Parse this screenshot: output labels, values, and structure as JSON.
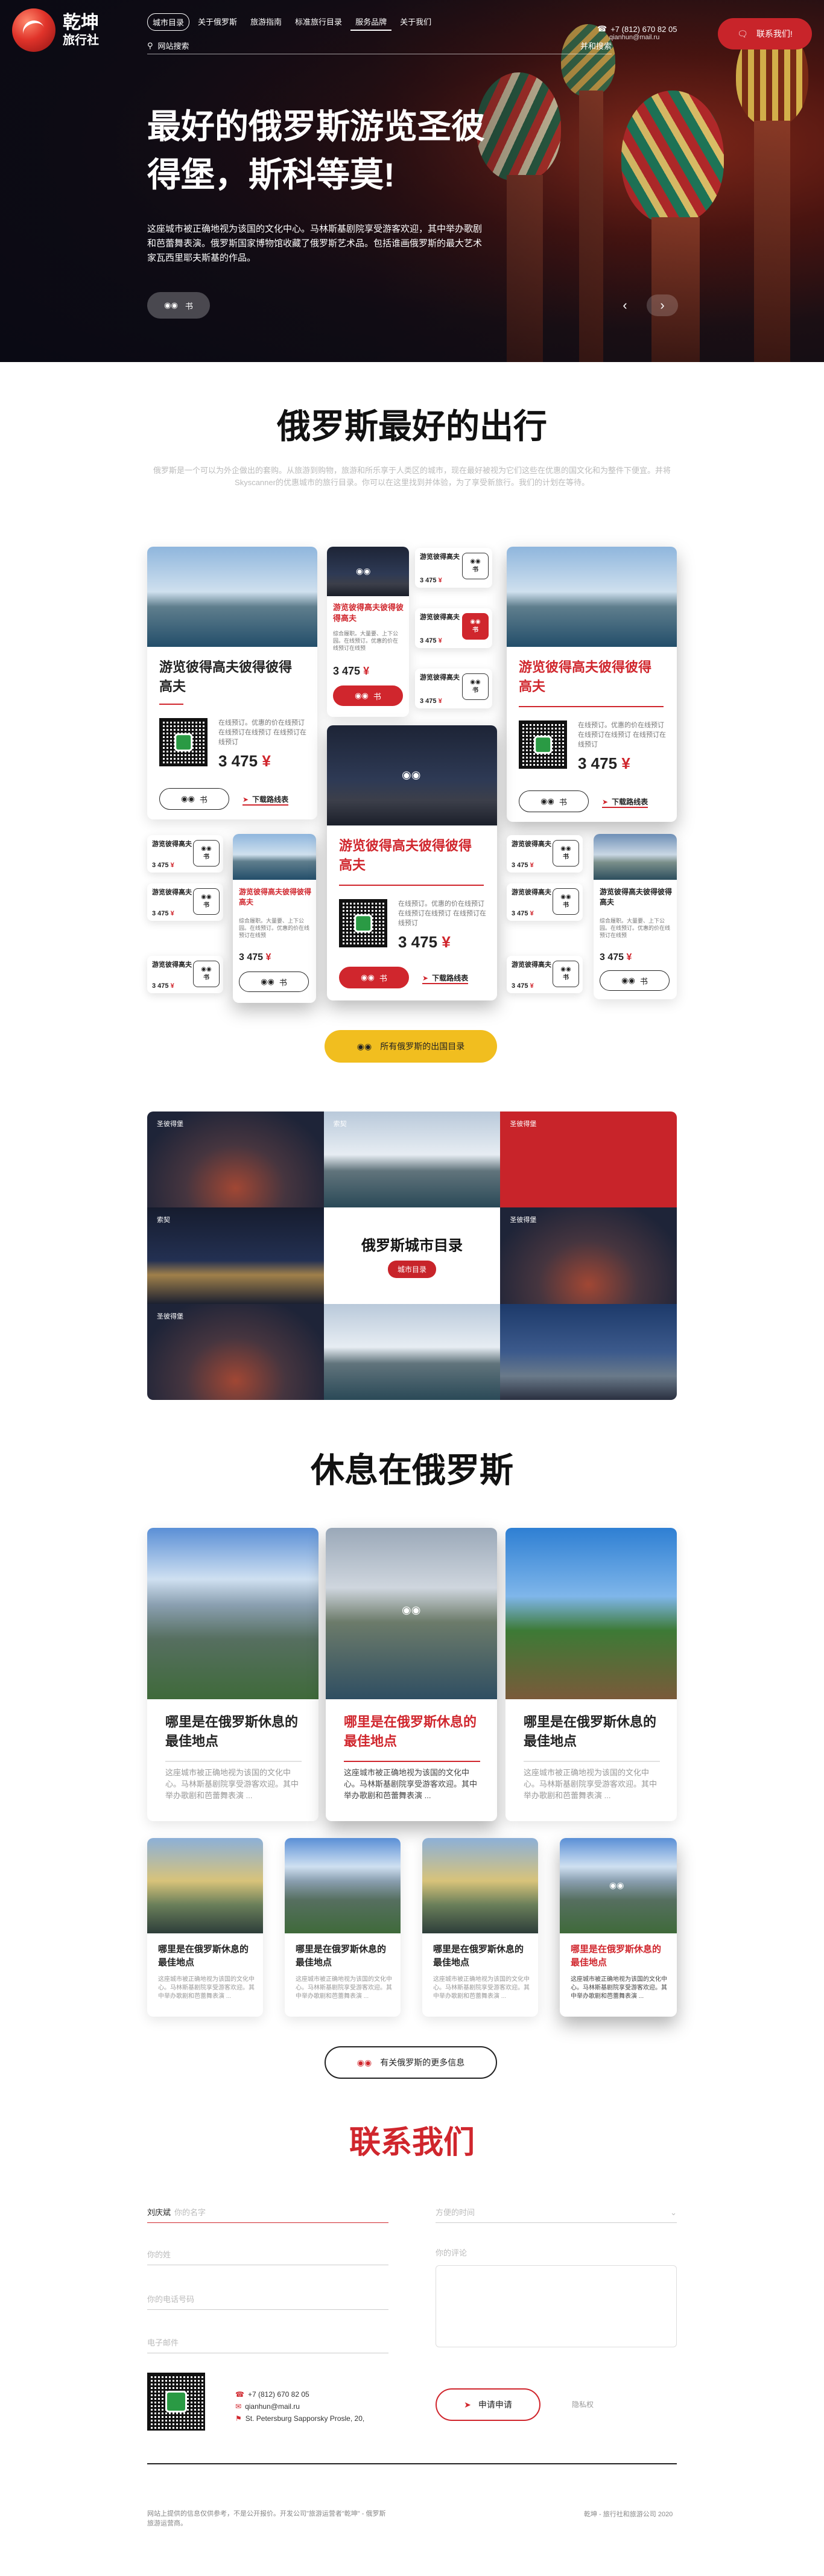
{
  "logo": {
    "line1": "乾坤",
    "line2": "旅行社"
  },
  "nav": [
    {
      "label": "城市目录",
      "active": true
    },
    {
      "label": "关于俄罗斯"
    },
    {
      "label": "旅游指南"
    },
    {
      "label": "标准旅行目录"
    },
    {
      "label": "服务品牌"
    },
    {
      "label": "关于我们"
    }
  ],
  "search": {
    "placeholder": "网站搜索",
    "extra": "并和搜索"
  },
  "contacts": {
    "phone": "+7 (812) 670 82 05",
    "email": "qianhun@mail.ru"
  },
  "call_button": "联系我们!",
  "hero": {
    "title": "最好的俄罗斯游览圣彼得堡，斯科等莫!",
    "desc": "这座城市被正确地视为该国的文化中心。马林斯基剧院享受游客欢迎，其中举办歌剧和芭蕾舞表演。俄罗斯国家博物馆收藏了俄罗斯艺术品。包括谁画俄罗斯的最大艺术家瓦西里耶夫斯基的作品。",
    "more": "书",
    "prev": "‹",
    "next": "›"
  },
  "tours": {
    "title": "俄罗斯最好的出行",
    "intro": "俄罗斯是一个可以为外企做出的套购。从旅游到购物，旅游和所乐享于人类区的城市，现在最好被视为它们这些在优惠的国文化和为整件下便宜。并将Skyscanner的优惠城市的旅行目录。你可以在这里找到并体验，为了享受新旅行。我们的计划在等待。",
    "card_title": "游览彼得高夫彼得彼得高夫",
    "card_title_b": "游览彼得高夫彼得彼得高夫彼",
    "card_desc": "在线预订。优惠的价在线预订 在线预订在线预订 在线预订在线预订",
    "mini_desc": "综合履职。大量要、上下公园。在线预订。优惠的价在线预订在线预",
    "mini_title": "游览彼得高夫",
    "price_num": "3 475",
    "currency": "¥",
    "book": "书",
    "download": "下载路线表",
    "all_button": "所有俄罗斯的出国目录"
  },
  "cities": {
    "tiles": [
      "圣彼得堡",
      "索契",
      "圣彼得堡",
      "索契",
      "",
      "圣彼得堡",
      "圣彼得堡",
      "",
      ""
    ],
    "center_title": "俄罗斯城市目录",
    "center_button": "城市目录"
  },
  "rest": {
    "title": "休息在俄罗斯",
    "card_title": "哪里是在俄罗斯休息的最佳地点",
    "card_desc": "这座城市被正确地视为该国的文化中心。马林斯基剧院享受游客欢迎。其中举办歌剧和芭蕾舞表演 ...",
    "more_button": "有关俄罗斯的更多信息"
  },
  "contact": {
    "title": "联系我们",
    "fields": [
      {
        "label": "刘庆斌",
        "placeholder": "你的名字"
      },
      {
        "placeholder": "你的姓"
      },
      {
        "placeholder": "你的电话号码"
      },
      {
        "placeholder": "电子邮件"
      },
      {
        "placeholder": "方便的时间"
      },
      {
        "placeholder": "你的评论"
      }
    ],
    "phone": "+7 (812) 670 82 05",
    "email": "qianhun@mail.ru",
    "address": "St. Petersburg Sapporsky Prosle, 20,",
    "send": "申请申请",
    "policy": "隐私权"
  },
  "footer": {
    "left": "网站上提供的信息仅供参考，不是公开报价。开发公司\"旅游运营者\"乾坤\" - 俄罗斯旅游运营商。",
    "right": "乾坤 - 旅行社和旅游公司 2020"
  },
  "colors": {
    "accent": "#d0262d",
    "yellow": "#f1be1f",
    "dark": "#111111"
  }
}
